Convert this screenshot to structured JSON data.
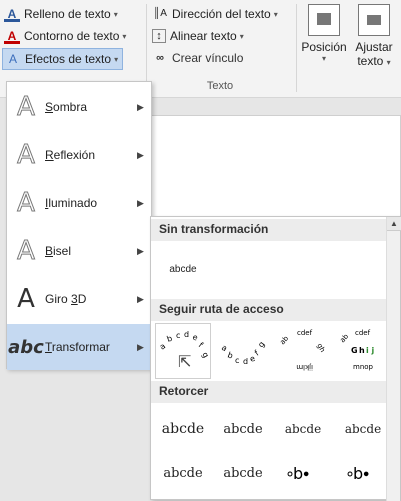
{
  "ribbon": {
    "fill_label": "Relleno de texto",
    "outline_label": "Contorno de texto",
    "effects_label": "Efectos de texto",
    "direction_label": "Dirección del texto",
    "align_label": "Alinear texto",
    "link_label": "Crear vínculo",
    "group_label": "Texto",
    "position_label": "Posición",
    "wrap_label_1": "Ajustar",
    "wrap_label_2": "texto"
  },
  "menu": {
    "items": [
      {
        "label": "Sombra",
        "key": "S"
      },
      {
        "label": "Reflexión",
        "key": "R"
      },
      {
        "label": "Iluminado",
        "key": "I"
      },
      {
        "label": "Bisel",
        "key": "B"
      },
      {
        "label": "Giro 3D",
        "key": "3"
      },
      {
        "label": "Transformar",
        "key": "T"
      }
    ]
  },
  "submenu": {
    "section1": "Sin transformación",
    "plain_sample": "abcde",
    "section2": "Seguir ruta de acceso",
    "section3": "Retorcer",
    "warp_samples": [
      "abcde",
      "abcde",
      "abcde",
      "abcde",
      "abcde",
      "abcde"
    ],
    "path_samples": [
      "abcdefg",
      "abcdefg",
      "abcdefghijklmn",
      "abcdefGhijklmnop"
    ]
  },
  "colors": {
    "accent_blue": "#2b579a",
    "outline_red": "#c00000",
    "highlight": "#c5d9f1"
  }
}
